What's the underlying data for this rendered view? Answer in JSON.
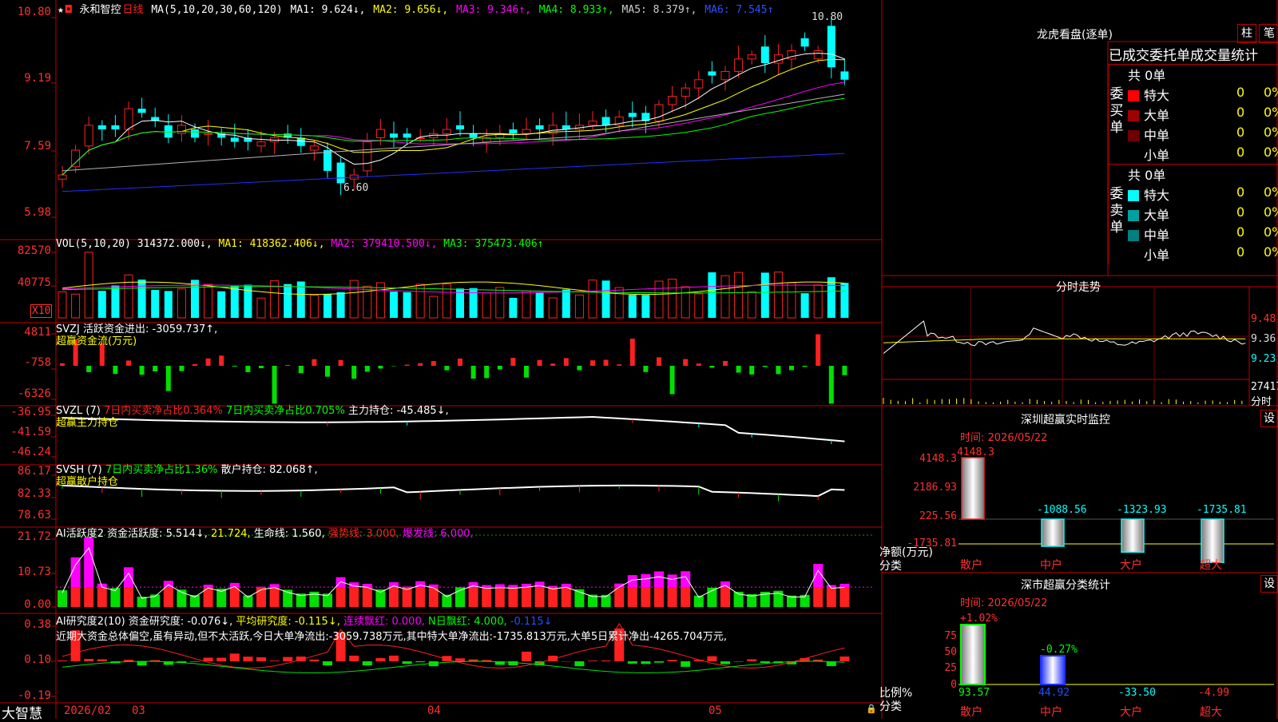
{
  "colors": {
    "up": "#ff2020",
    "down": "#00ffff",
    "frame": "#c00000",
    "ma1": "#ffffff",
    "ma2": "#ffff00",
    "ma3": "#ff00ff",
    "ma4": "#00ff00",
    "ma5": "#b4b4b4",
    "ma6": "#2030ff",
    "green": "#00e000",
    "yellow": "#ffff00",
    "magenta": "#ff00ff",
    "cyan": "#00ffff"
  },
  "header": {
    "star": "★",
    "stock": "永和智控",
    "period": "日线",
    "ma_label": "MA(5,10,20,30,60,120)",
    "ma1": "MA1: 9.624↓,",
    "ma2": "MA2: 9.656↓,",
    "ma3": "MA3: 9.346↑,",
    "ma4": "MA4: 8.933↑,",
    "ma5": "MA5: 8.379↑,",
    "ma6": "MA6: 7.545↑"
  },
  "price_axis": [
    "10.80",
    "9.19",
    "7.59",
    "5.98"
  ],
  "price_marks": {
    "high": "10.80",
    "low": "6.60"
  },
  "vol": {
    "label": "VOL(5,10,20)",
    "value": "314372.000↓,",
    "ma1": "MA1: 418362.406↓,",
    "ma2": "MA2: 379410.500↓,",
    "ma3": "MA3: 375473.406↑",
    "axis": [
      "82570",
      "40775"
    ],
    "unit": "X10"
  },
  "svzj": {
    "label": "SVZJ  活跃资金进出: -3059.737↑,",
    "title": "超赢资金流(万元)",
    "axis": [
      "4811",
      "-758",
      "-6326"
    ]
  },
  "svzl": {
    "label": "SVZL (7)",
    "part1": "7日内买卖净占比0.364%",
    "part2": "7日内买卖净占比0.705%",
    "part3": "主力持仓: -45.485↓,",
    "title": "超赢主力持仓",
    "axis": [
      "-36.95",
      "-41.59",
      "-46.24"
    ]
  },
  "svsh": {
    "label": "SVSH (7)",
    "part1": "7日内买卖净占比1.36%",
    "part2": "散户持仓: 82.068↑,",
    "title": "超赢散户持仓",
    "axis": [
      "86.17",
      "82.33",
      "78.63"
    ]
  },
  "ai1": {
    "label": "AI活跃度2 资金活跃度: 5.514↓,",
    "v1": "21.724,",
    "v2": "生命线: 1.560,",
    "v3": "强势线: 3.000,",
    "v4": "爆发线: 6.000,",
    "axis": [
      "21.72",
      "10.73",
      "0.00"
    ]
  },
  "ai2": {
    "label": "AI研究度2(10) 资金研究度: -0.076↓,",
    "v1": "平均研究度: -0.115↓,",
    "v2": "连续飘红: 0.000,",
    "v3": "N日飘红: 4.000,",
    "v4": "-0.115↓",
    "comment": "近期大资金总体偏空,虽有异动,但不太活跃,今日大单净流出:-3059.738万元,其中特大单净流出:-1735.813万元,大单5日累计净出-4265.704万元,",
    "axis": [
      "0.38",
      "0.10",
      "-0.19"
    ]
  },
  "date_axis": {
    "brand": "大智慧",
    "labels": [
      "2026/02",
      "03",
      "04",
      "05"
    ]
  },
  "lhb": {
    "title": "龙虎看盘(逐单)",
    "btn1": "柱",
    "btn2": "笔",
    "tabs": "已成交委托单成交量统计",
    "buy": {
      "side": "委买单",
      "total": "共 0单",
      "rows": [
        {
          "name": "特大",
          "v": "0",
          "p": "0%",
          "c": "#ff0000"
        },
        {
          "name": "大单",
          "v": "0",
          "p": "0%",
          "c": "#a00000"
        },
        {
          "name": "中单",
          "v": "0",
          "p": "0%",
          "c": "#700000"
        },
        {
          "name": "小单",
          "v": "0",
          "p": "0%",
          "c": ""
        }
      ]
    },
    "sell": {
      "side": "委卖单",
      "total": "共 0单",
      "rows": [
        {
          "name": "特大",
          "v": "0",
          "p": "0%",
          "c": "#00ffff"
        },
        {
          "name": "大单",
          "v": "0",
          "p": "0%",
          "c": "#00a0a0"
        },
        {
          "name": "中单",
          "v": "0",
          "p": "0%",
          "c": "#008080"
        },
        {
          "name": "小单",
          "v": "0",
          "p": "0%",
          "c": ""
        }
      ]
    }
  },
  "fenshi": {
    "title": "分时走势",
    "axis": [
      "9.48",
      "9.36",
      "9.23"
    ],
    "vol": "27417",
    "vol2": "分时"
  },
  "sz_monitor": {
    "title": "深圳超赢实时监控",
    "btn": "设",
    "time": "时间: 2026/05/22",
    "axis": [
      "4148.3",
      "2186.93",
      "225.56",
      "-1735.81"
    ],
    "unit1": "净额(万元)",
    "unit2": "分类",
    "bars": [
      {
        "name": "散户",
        "value": 4148.3,
        "label": "4148.3"
      },
      {
        "name": "中户",
        "value": -1088.56,
        "label": "-1088.56"
      },
      {
        "name": "大户",
        "value": -1323.93,
        "label": "-1323.93"
      },
      {
        "name": "超大",
        "value": -1735.81,
        "label": "-1735.81"
      }
    ]
  },
  "sz_class": {
    "title": "深市超赢分类统计",
    "btn": "设",
    "time": "时间: 2026/05/22",
    "axis": [
      "75",
      "50",
      "25",
      "0"
    ],
    "unit1": "比例%",
    "unit2": "分类",
    "bars": [
      {
        "name": "散户",
        "value": 93.57,
        "top": "+1.02%",
        "bottom": "93.57"
      },
      {
        "name": "中户",
        "value": 44.92,
        "top": "-0.27%",
        "bottom": "44.92"
      },
      {
        "name": "大户",
        "value": -33.5,
        "top": "",
        "bottom": "-33.50"
      },
      {
        "name": "超大",
        "value": -4.99,
        "top": "",
        "bottom": "-4.99"
      }
    ]
  }
}
